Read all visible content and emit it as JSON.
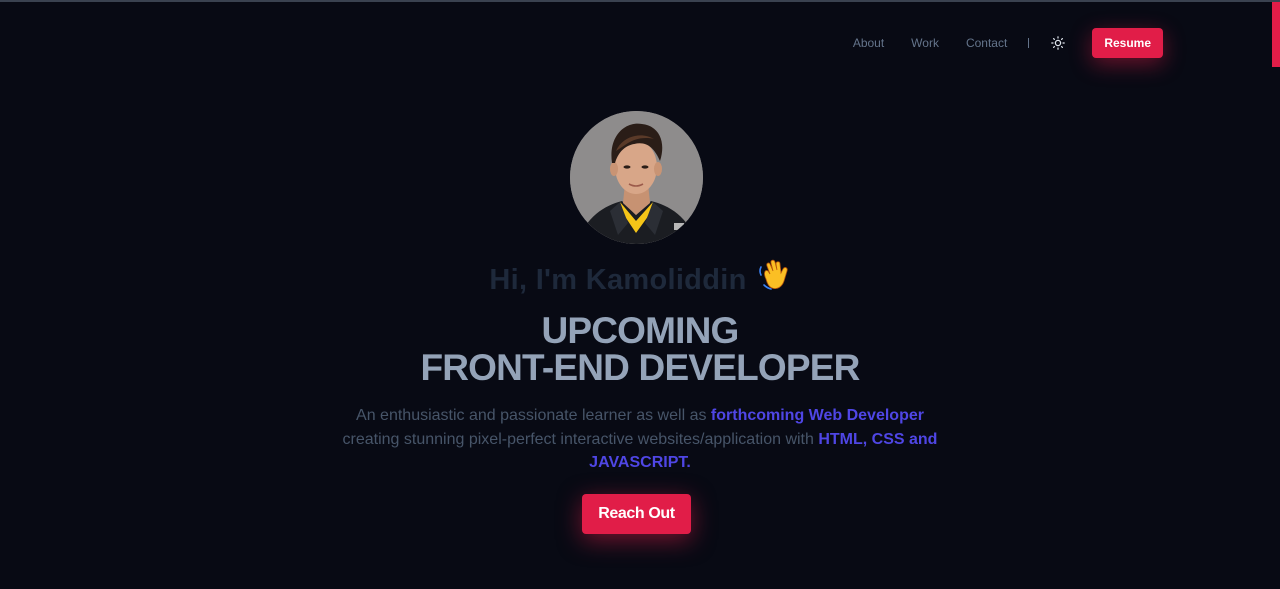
{
  "nav": {
    "links": [
      "About",
      "Work",
      "Contact"
    ],
    "theme_icon": "sun-icon",
    "resume_label": "Resume"
  },
  "hero": {
    "avatar_alt": "Kamoliddin",
    "greeting": "Hi, I'm Kamoliddin",
    "wave_icon": "waving-hand-icon",
    "headline_line1": "UPCOMING",
    "headline_line2": "FRONT-END DEVELOPER",
    "intro": {
      "part1": "An enthusiastic and passionate learner as well as ",
      "highlight1": "forthcoming Web Developer",
      "part2": " creating stunning pixel-perfect interactive websites/application with ",
      "highlight2": "HTML, CSS and JAVASCRIPT."
    },
    "cta_label": "Reach Out"
  },
  "colors": {
    "background": "#080a14",
    "accent": "#e11d48",
    "highlight": "#4f46e5",
    "headline": "#94a3b8"
  }
}
